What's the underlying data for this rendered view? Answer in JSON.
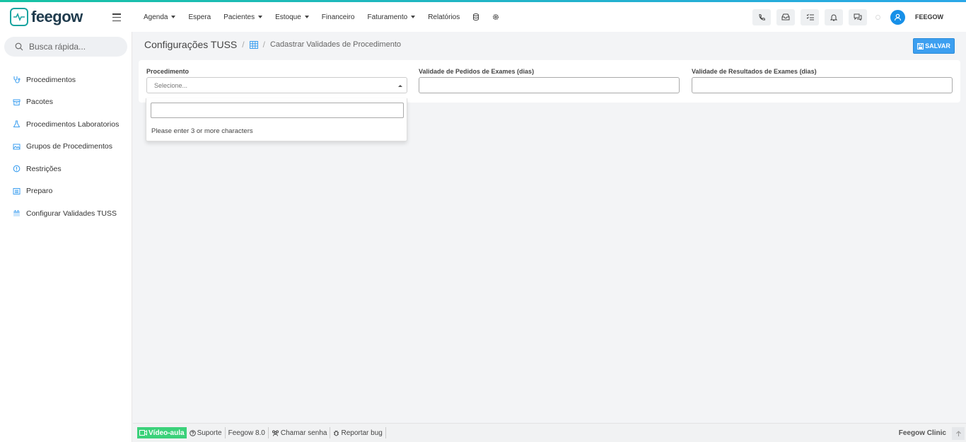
{
  "brand": {
    "name": "feegow",
    "accent": "#18a4a0",
    "primary": "#3c9ff0"
  },
  "topnav": [
    {
      "label": "Agenda",
      "dropdown": true
    },
    {
      "label": "Espera",
      "dropdown": false
    },
    {
      "label": "Pacientes",
      "dropdown": true
    },
    {
      "label": "Estoque",
      "dropdown": true
    },
    {
      "label": "Financeiro",
      "dropdown": false
    },
    {
      "label": "Faturamento",
      "dropdown": true
    },
    {
      "label": "Relatórios",
      "dropdown": false
    }
  ],
  "header": {
    "user": "FEEGOW"
  },
  "sidebar": {
    "search_placeholder": "Busca rápida...",
    "items": [
      {
        "label": "Procedimentos",
        "icon": "stethoscope-icon"
      },
      {
        "label": "Pacotes",
        "icon": "box-icon"
      },
      {
        "label": "Procedimentos Laboratorios",
        "icon": "flask-icon"
      },
      {
        "label": "Grupos de Procedimentos",
        "icon": "image-group-icon"
      },
      {
        "label": "Restrições",
        "icon": "info-circle-icon"
      },
      {
        "label": "Preparo",
        "icon": "list-icon"
      },
      {
        "label": "Configurar Validades TUSS",
        "icon": "calendar-icon"
      }
    ]
  },
  "page": {
    "title": "Configurações TUSS",
    "breadcrumb": "Cadastrar Validades de Procedimento",
    "save_label": "SALVAR"
  },
  "form": {
    "procedimento_label": "Procedimento",
    "procedimento_placeholder": "Selecione...",
    "pedidos_label": "Validade de Pedidos de Exames (dias)",
    "resultados_label": "Validade de Resultados de Exames (dias)",
    "dropdown_message": "Please enter 3 or more characters"
  },
  "footer": {
    "video": "Vídeo-aula",
    "suporte": "Suporte",
    "version": "Feegow 8.0",
    "chamar": "Chamar senha",
    "bug": "Reportar bug",
    "right": "Feegow Clinic"
  }
}
